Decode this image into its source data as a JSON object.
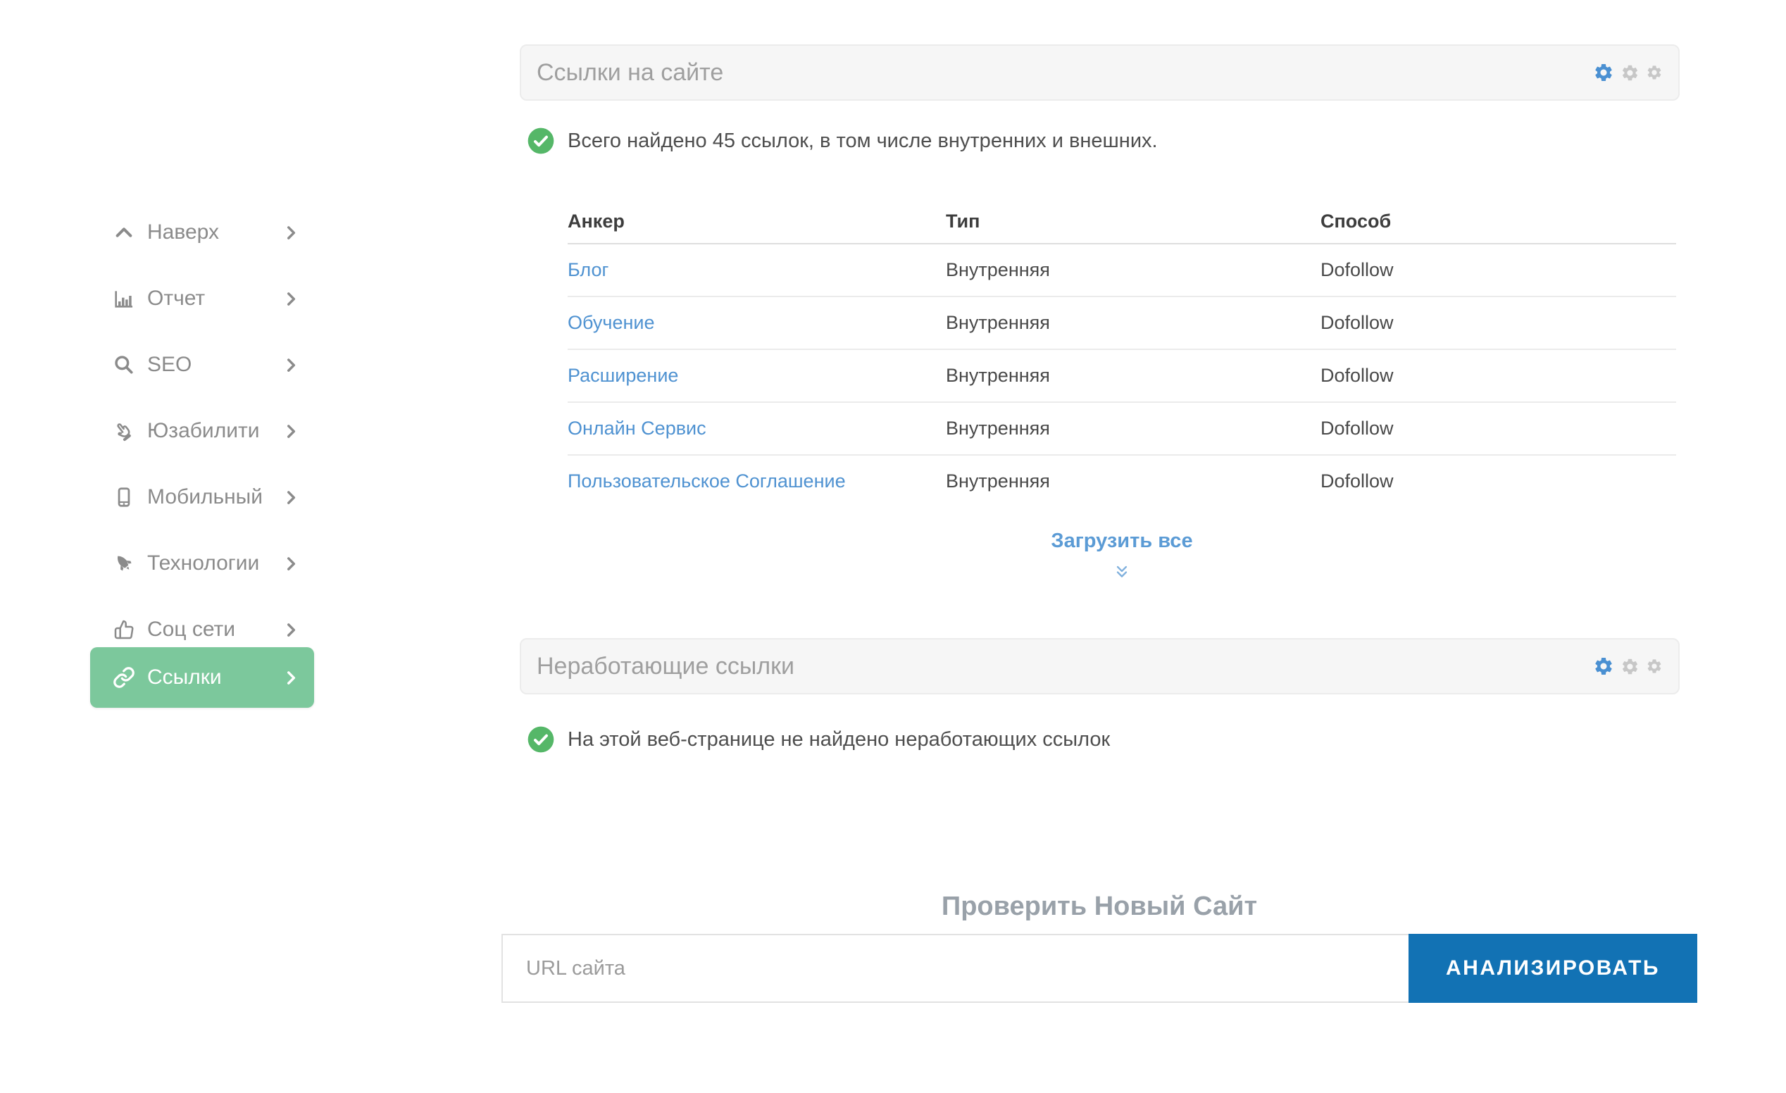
{
  "sidebar": {
    "items": [
      {
        "label": "Наверх"
      },
      {
        "label": "Отчет"
      },
      {
        "label": "SEO"
      },
      {
        "label": "Юзабилити"
      },
      {
        "label": "Мобильный"
      },
      {
        "label": "Технологии"
      },
      {
        "label": "Соц сети"
      },
      {
        "label": "Ссылки",
        "active": true
      }
    ]
  },
  "links_panel": {
    "title": "Ссылки на сайте",
    "status": "Всего найдено 45 ссылок, в том числе внутренних и внешних.",
    "table": {
      "headers": [
        "Анкер",
        "Тип",
        "Способ"
      ],
      "rows": [
        {
          "anchor": "Блог",
          "type": "Внутренняя",
          "method": "Dofollow"
        },
        {
          "anchor": "Обучение",
          "type": "Внутренняя",
          "method": "Dofollow"
        },
        {
          "anchor": "Расширение",
          "type": "Внутренняя",
          "method": "Dofollow"
        },
        {
          "anchor": "Онлайн Сервис",
          "type": "Внутренняя",
          "method": "Dofollow"
        },
        {
          "anchor": "Пользовательское Соглашение",
          "type": "Внутренняя",
          "method": "Dofollow"
        }
      ]
    },
    "load_all_label": "Загрузить все"
  },
  "broken_panel": {
    "title": "Неработающие ссылки",
    "status": "На этой веб-странице не найдено неработающих ссылок"
  },
  "new_site": {
    "heading": "Проверить Новый Сайт",
    "url_placeholder": "URL сайта",
    "analyze_label": "АНАЛИЗИРОВАТЬ"
  },
  "colors": {
    "active-green": "#7cc89c",
    "success-green": "#55b768",
    "link-blue": "#4f92d1",
    "load-more-blue": "#5b9bd5",
    "gear-blue": "#4a90d2",
    "button-blue": "#1272b4"
  }
}
